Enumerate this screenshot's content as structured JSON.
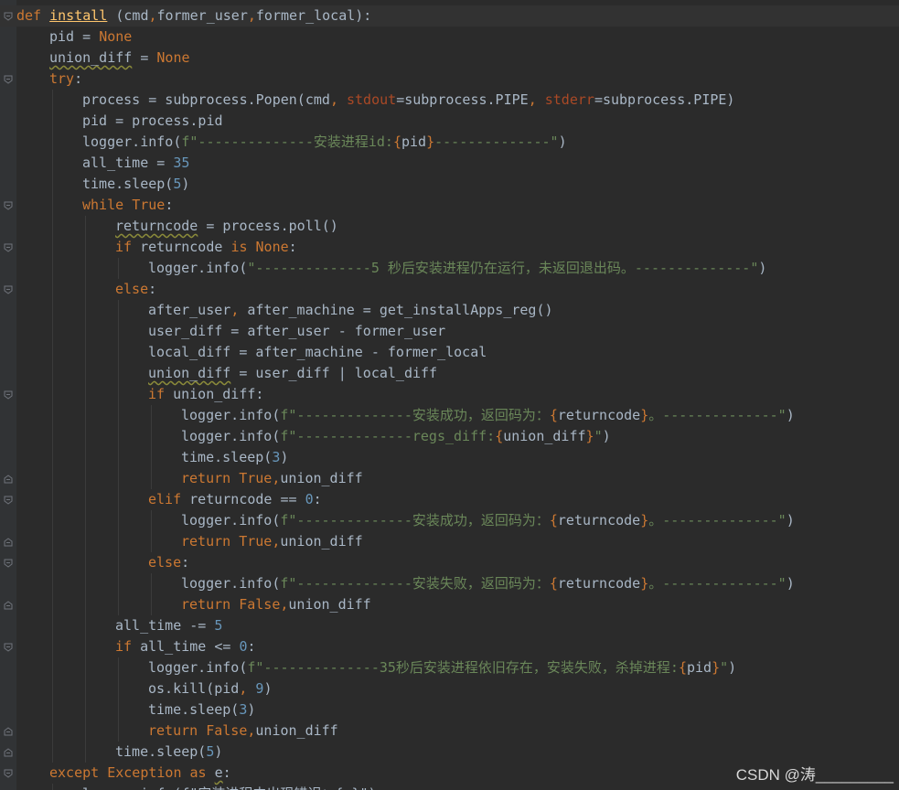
{
  "editor": {
    "watermark": "CSDN @涛_________",
    "lines": [
      {
        "indent": 0,
        "fold": "start",
        "tokens": [
          [
            "kw",
            "def "
          ],
          [
            "fnhl",
            "install"
          ],
          [
            "def",
            " "
          ],
          [
            "def",
            "(cmd"
          ],
          [
            "kw",
            ","
          ],
          [
            "def",
            "former_user"
          ],
          [
            "kw",
            ","
          ],
          [
            "def",
            "former_local):"
          ]
        ]
      },
      {
        "indent": 1,
        "tokens": [
          [
            "def",
            "pid = "
          ],
          [
            "kw",
            "None"
          ]
        ]
      },
      {
        "indent": 1,
        "tokens": [
          [
            "wavy",
            "union_diff"
          ],
          [
            "def",
            " = "
          ],
          [
            "kw",
            "None"
          ]
        ]
      },
      {
        "indent": 1,
        "fold": "start",
        "tokens": [
          [
            "kw",
            "try"
          ],
          [
            "def",
            ":"
          ]
        ]
      },
      {
        "indent": 2,
        "tokens": [
          [
            "def",
            "process = subprocess.Popen(cmd"
          ],
          [
            "kw",
            ", "
          ],
          [
            "prm",
            "stdout"
          ],
          [
            "def",
            "=subprocess.PIPE"
          ],
          [
            "kw",
            ", "
          ],
          [
            "prm",
            "stderr"
          ],
          [
            "def",
            "=subprocess.PIPE)"
          ]
        ]
      },
      {
        "indent": 2,
        "tokens": [
          [
            "def",
            "pid = process.pid"
          ]
        ]
      },
      {
        "indent": 2,
        "tokens": [
          [
            "def",
            "logger.info("
          ],
          [
            "str",
            "f\"--------------安装进程id:"
          ],
          [
            "kw",
            "{"
          ],
          [
            "def",
            "pid"
          ],
          [
            "kw",
            "}"
          ],
          [
            "str",
            "--------------\""
          ],
          [
            "def",
            ")"
          ]
        ]
      },
      {
        "indent": 2,
        "tokens": [
          [
            "def",
            "all_time = "
          ],
          [
            "num",
            "35"
          ]
        ]
      },
      {
        "indent": 2,
        "tokens": [
          [
            "def",
            "time.sleep("
          ],
          [
            "num",
            "5"
          ],
          [
            "def",
            ")"
          ]
        ]
      },
      {
        "indent": 2,
        "fold": "start",
        "tokens": [
          [
            "kw",
            "while "
          ],
          [
            "kw",
            "True"
          ],
          [
            "def",
            ":"
          ]
        ]
      },
      {
        "indent": 3,
        "tokens": [
          [
            "wavy",
            "returncode"
          ],
          [
            "def",
            " = process.poll()"
          ]
        ]
      },
      {
        "indent": 3,
        "fold": "start",
        "tokens": [
          [
            "kw",
            "if "
          ],
          [
            "def",
            "returncode "
          ],
          [
            "kw",
            "is "
          ],
          [
            "kw",
            "None"
          ],
          [
            "def",
            ":"
          ]
        ]
      },
      {
        "indent": 4,
        "tokens": [
          [
            "def",
            "logger.info("
          ],
          [
            "str",
            "\"--------------5 秒后安装进程仍在运行，未返回退出码。--------------\""
          ],
          [
            "def",
            ")"
          ]
        ]
      },
      {
        "indent": 3,
        "fold": "start",
        "tokens": [
          [
            "kw",
            "else"
          ],
          [
            "def",
            ":"
          ]
        ]
      },
      {
        "indent": 4,
        "tokens": [
          [
            "def",
            "after_user"
          ],
          [
            "kw",
            ", "
          ],
          [
            "def",
            "after_machine = get_installApps_reg()"
          ]
        ]
      },
      {
        "indent": 4,
        "tokens": [
          [
            "def",
            "user_diff = after_user - former_user"
          ]
        ]
      },
      {
        "indent": 4,
        "tokens": [
          [
            "def",
            "local_diff = after_machine - former_local"
          ]
        ]
      },
      {
        "indent": 4,
        "tokens": [
          [
            "wavy",
            "union_diff"
          ],
          [
            "def",
            " = user_diff | local_diff"
          ]
        ]
      },
      {
        "indent": 4,
        "fold": "start",
        "tokens": [
          [
            "kw",
            "if "
          ],
          [
            "def",
            "union_diff:"
          ]
        ]
      },
      {
        "indent": 5,
        "tokens": [
          [
            "def",
            "logger.info("
          ],
          [
            "str",
            "f\"--------------安装成功，返回码为："
          ],
          [
            "kw",
            "{"
          ],
          [
            "def",
            "returncode"
          ],
          [
            "kw",
            "}"
          ],
          [
            "str",
            "。--------------\""
          ],
          [
            "def",
            ")"
          ]
        ]
      },
      {
        "indent": 5,
        "tokens": [
          [
            "def",
            "logger.info("
          ],
          [
            "str",
            "f\"--------------regs_diff:"
          ],
          [
            "kw",
            "{"
          ],
          [
            "def",
            "union_diff"
          ],
          [
            "kw",
            "}"
          ],
          [
            "str",
            "\""
          ],
          [
            "def",
            ")"
          ]
        ]
      },
      {
        "indent": 5,
        "tokens": [
          [
            "def",
            "time.sleep("
          ],
          [
            "num",
            "3"
          ],
          [
            "def",
            ")"
          ]
        ]
      },
      {
        "indent": 5,
        "fold": "end",
        "tokens": [
          [
            "kw",
            "return "
          ],
          [
            "kw",
            "True"
          ],
          [
            "kw",
            ","
          ],
          [
            "def",
            "union_diff"
          ]
        ]
      },
      {
        "indent": 4,
        "fold": "start",
        "tokens": [
          [
            "kw",
            "elif "
          ],
          [
            "def",
            "returncode == "
          ],
          [
            "num",
            "0"
          ],
          [
            "def",
            ":"
          ]
        ]
      },
      {
        "indent": 5,
        "tokens": [
          [
            "def",
            "logger.info("
          ],
          [
            "str",
            "f\"--------------安装成功，返回码为："
          ],
          [
            "kw",
            "{"
          ],
          [
            "def",
            "returncode"
          ],
          [
            "kw",
            "}"
          ],
          [
            "str",
            "。--------------\""
          ],
          [
            "def",
            ")"
          ]
        ]
      },
      {
        "indent": 5,
        "fold": "end",
        "tokens": [
          [
            "kw",
            "return "
          ],
          [
            "kw",
            "True"
          ],
          [
            "kw",
            ","
          ],
          [
            "def",
            "union_diff"
          ]
        ]
      },
      {
        "indent": 4,
        "fold": "start",
        "tokens": [
          [
            "kw",
            "else"
          ],
          [
            "def",
            ":"
          ]
        ]
      },
      {
        "indent": 5,
        "tokens": [
          [
            "def",
            "logger.info("
          ],
          [
            "str",
            "f\"--------------安装失败，返回码为："
          ],
          [
            "kw",
            "{"
          ],
          [
            "def",
            "returncode"
          ],
          [
            "kw",
            "}"
          ],
          [
            "str",
            "。--------------\""
          ],
          [
            "def",
            ")"
          ]
        ]
      },
      {
        "indent": 5,
        "fold": "end",
        "tokens": [
          [
            "kw",
            "return "
          ],
          [
            "kw",
            "False"
          ],
          [
            "kw",
            ","
          ],
          [
            "def",
            "union_diff"
          ]
        ]
      },
      {
        "indent": 3,
        "tokens": [
          [
            "def",
            "all_time -= "
          ],
          [
            "num",
            "5"
          ]
        ]
      },
      {
        "indent": 3,
        "fold": "start",
        "tokens": [
          [
            "kw",
            "if "
          ],
          [
            "def",
            "all_time <= "
          ],
          [
            "num",
            "0"
          ],
          [
            "def",
            ":"
          ]
        ]
      },
      {
        "indent": 4,
        "tokens": [
          [
            "def",
            "logger.info("
          ],
          [
            "str",
            "f\"--------------35秒后安装进程依旧存在，安装失败，杀掉进程:"
          ],
          [
            "kw",
            "{"
          ],
          [
            "def",
            "pid"
          ],
          [
            "kw",
            "}"
          ],
          [
            "str",
            "\""
          ],
          [
            "def",
            ")"
          ]
        ]
      },
      {
        "indent": 4,
        "tokens": [
          [
            "def",
            "os.kill(pid"
          ],
          [
            "kw",
            ", "
          ],
          [
            "num",
            "9"
          ],
          [
            "def",
            ")"
          ]
        ]
      },
      {
        "indent": 4,
        "tokens": [
          [
            "def",
            "time.sleep("
          ],
          [
            "num",
            "3"
          ],
          [
            "def",
            ")"
          ]
        ]
      },
      {
        "indent": 4,
        "fold": "end",
        "tokens": [
          [
            "kw",
            "return "
          ],
          [
            "kw",
            "False"
          ],
          [
            "kw",
            ","
          ],
          [
            "def",
            "union_diff"
          ]
        ]
      },
      {
        "indent": 3,
        "fold": "end",
        "tokens": [
          [
            "def",
            "time.sleep("
          ],
          [
            "num",
            "5"
          ],
          [
            "def",
            ")"
          ]
        ]
      },
      {
        "indent": 1,
        "fold": "start",
        "tokens": [
          [
            "kw",
            "except "
          ],
          [
            "kw",
            "Exception "
          ],
          [
            "kw",
            "as "
          ],
          [
            "wavy",
            "e"
          ],
          [
            "def",
            ":"
          ]
        ]
      },
      {
        "indent": 2,
        "tokens": [
          [
            "def",
            "logger.info(f\"安装进程中出现错误：{e}\")"
          ]
        ]
      }
    ]
  }
}
